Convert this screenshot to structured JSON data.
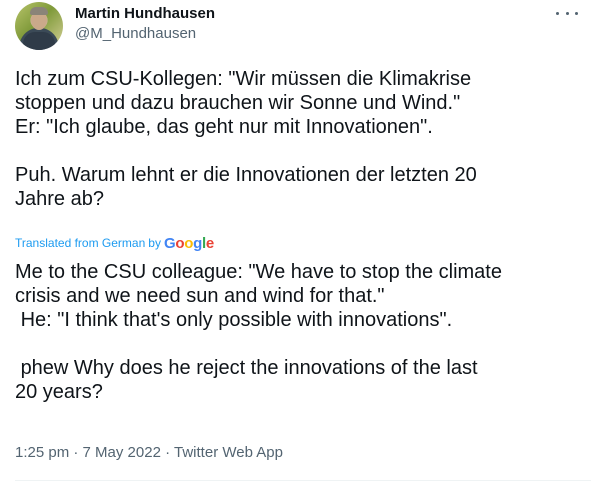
{
  "author": {
    "display_name": "Martin Hundhausen",
    "handle": "@M_Hundhausen"
  },
  "tweet": {
    "original_text": "Ich zum CSU-Kollegen: \"Wir müssen die Klimakrise\nstoppen und dazu brauchen wir Sonne und Wind.\"\nEr: \"Ich glaube, das geht nur mit Innovationen\".\n\nPuh. Warum lehnt er die Innovationen der letzten 20\nJahre ab?",
    "translated_label": "Translated from German",
    "by_label": "by",
    "translation_provider": "Google",
    "translated_text": "Me to the CSU colleague: \"We have to stop the climate\ncrisis and we need sun and wind for that.\"\n He: \"I think that's only possible with innovations\".\n\n phew Why does he reject the innovations of the last\n20 years?"
  },
  "meta": {
    "time": "1:25 pm",
    "separator": "·",
    "date": "7 May 2022",
    "source": "Twitter Web App"
  },
  "icons": {
    "more": "more-options-icon",
    "avatar": "avatar"
  },
  "colors": {
    "text": "#0f1419",
    "secondary": "#536471",
    "link": "#1d9bf0"
  }
}
